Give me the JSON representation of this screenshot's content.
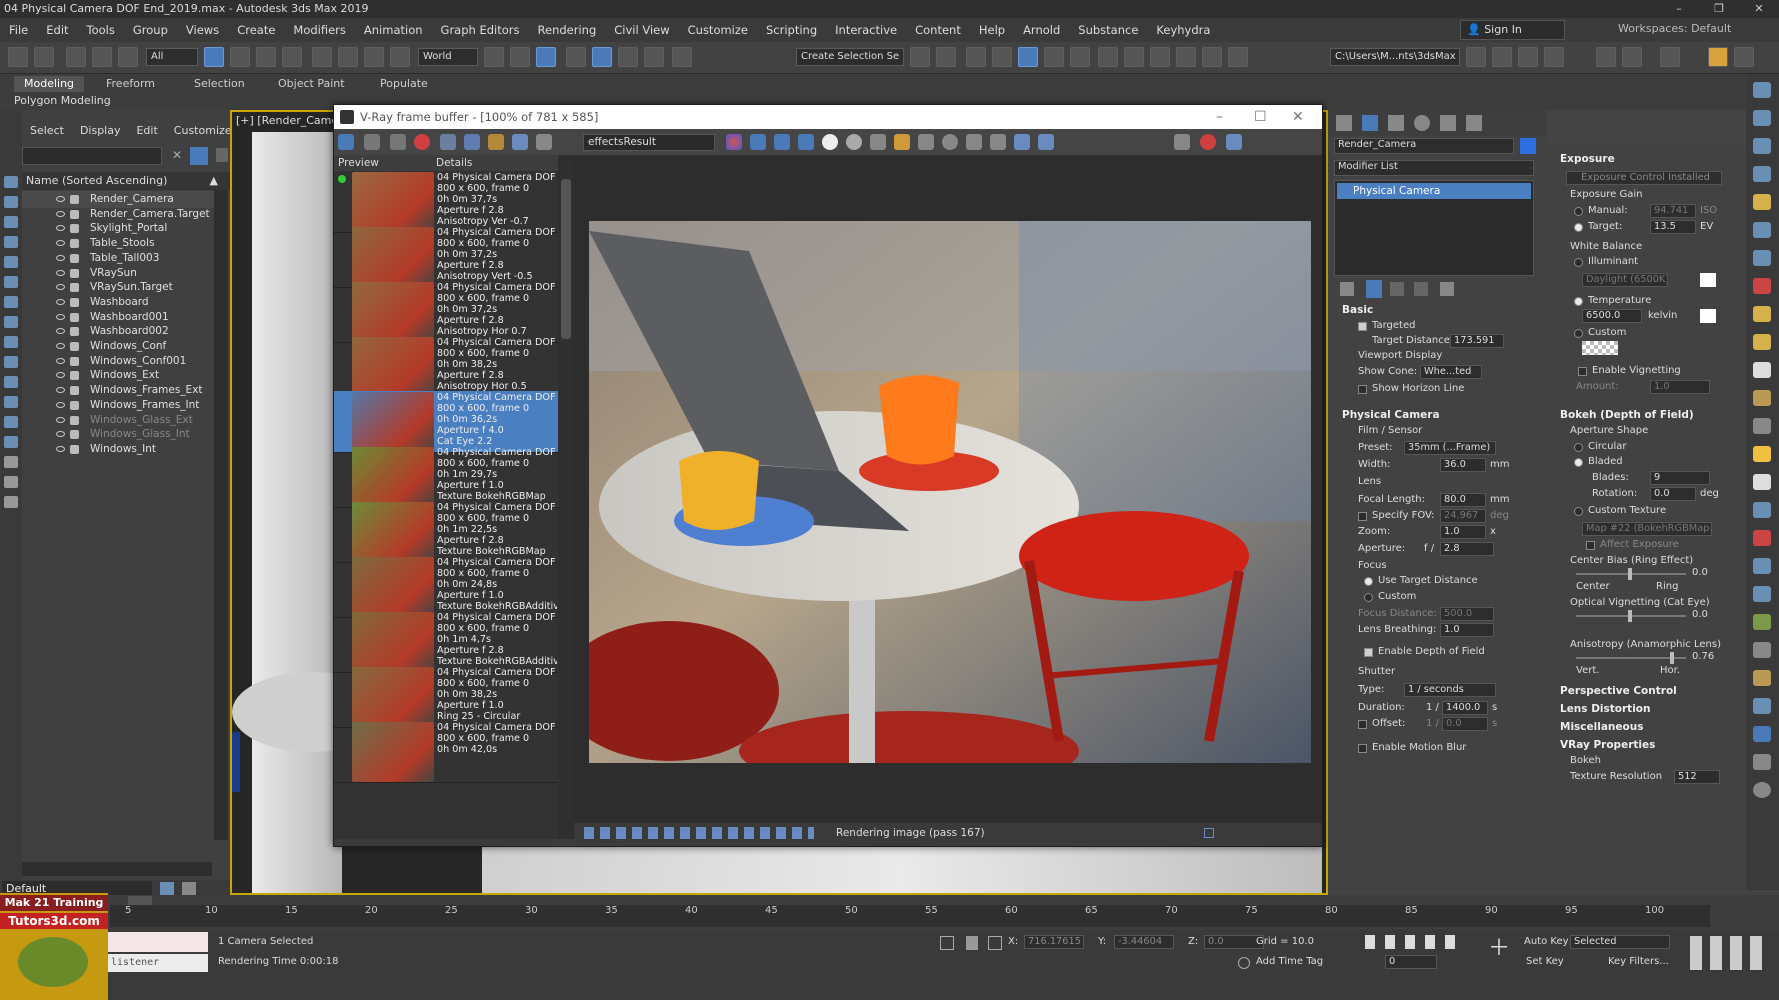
{
  "window": {
    "title": "04 Physical Camera DOF End_2019.max - Autodesk 3ds Max 2019"
  },
  "menu": [
    "File",
    "Edit",
    "Tools",
    "Group",
    "Views",
    "Create",
    "Modifiers",
    "Animation",
    "Graph Editors",
    "Rendering",
    "Civil View",
    "Customize",
    "Scripting",
    "Interactive",
    "Content",
    "Help",
    "Arnold",
    "Substance",
    "Keyhydra"
  ],
  "account": {
    "sign_in": "Sign In",
    "workspaces_label": "Workspaces:",
    "workspace": "Default"
  },
  "toolbar": {
    "filter": "All",
    "refcoord": "World",
    "selection_set": "Create Selection Se",
    "path": "C:\\Users\\M...nts\\3dsMax"
  },
  "ribbon": {
    "tabs": [
      "Modeling",
      "Freeform",
      "Selection",
      "Object Paint",
      "Populate"
    ],
    "sub": "Polygon Modeling"
  },
  "explorer": {
    "tabs": [
      "Select",
      "Display",
      "Edit",
      "Customize"
    ],
    "header": "Name (Sorted Ascending)",
    "items": [
      "Render_Camera",
      "Render_Camera.Target",
      "Skylight_Portal",
      "Table_Stools",
      "Table_Tall003",
      "VRaySun",
      "VRaySun.Target",
      "Washboard",
      "Washboard001",
      "Washboard002",
      "Windows_Conf",
      "Windows_Conf001",
      "Windows_Ext",
      "Windows_Frames_Ext",
      "Windows_Frames_Int",
      "Windows_Glass_Ext",
      "Windows_Glass_Int",
      "Windows_Int"
    ],
    "layer": "Default"
  },
  "viewport": {
    "label": "[+] [Render_Came"
  },
  "vfb": {
    "title": "V-Ray frame buffer - [100% of 781 x 585]",
    "channel": "effectsResult",
    "history_headers": [
      "Preview",
      "Details"
    ],
    "history": [
      [
        "04 Physical Camera DOF E",
        "800 x 600, frame 0",
        "0h 0m 37,7s",
        "Aperture f 2.8",
        "Anisotropy Ver -0.7"
      ],
      [
        "04 Physical Camera DOF E",
        "800 x 600, frame 0",
        "0h 0m 37,2s",
        "Aperture f 2.8",
        "Anisotropy Vert -0.5"
      ],
      [
        "04 Physical Camera DOF E",
        "800 x 600, frame 0",
        "0h 0m 37,2s",
        "Aperture f 2.8",
        "Anisotropy Hor 0.7"
      ],
      [
        "04 Physical Camera DOF E",
        "800 x 600, frame 0",
        "0h 0m 38,2s",
        "Aperture f 2.8",
        "Anisotropy Hor 0.5"
      ],
      [
        "04 Physical Camera DOF E",
        "800 x 600, frame 0",
        "0h 0m 36,2s",
        "Aperture f 4.0",
        "Cat Eye 2.2"
      ],
      [
        "04 Physical Camera DOF E",
        "800 x 600, frame 0",
        "0h 1m 29,7s",
        "Aperture f 1.0",
        "Texture BokehRGBMap"
      ],
      [
        "04 Physical Camera DOF E",
        "800 x 600, frame 0",
        "0h 1m 22,5s",
        "Aperture f 2.8",
        "Texture BokehRGBMap"
      ],
      [
        "04 Physical Camera DOF E",
        "800 x 600, frame 0",
        "0h 0m 24,8s",
        "Aperture f 1.0",
        "Texture BokehRGBAdditive"
      ],
      [
        "04 Physical Camera DOF E",
        "800 x 600, frame 0",
        "0h 1m 4,7s",
        "Aperture f 2.8",
        "Texture BokehRGBAdditive"
      ],
      [
        "04 Physical Camera DOF E",
        "800 x 600, frame 0",
        "0h 0m 38,2s",
        "Aperture f 1.0",
        "Ring 25 - Circular"
      ],
      [
        "04 Physical Camera DOF E",
        "800 x 600, frame 0",
        "0h 0m 42,0s",
        "",
        ""
      ]
    ],
    "status": "Rendering image (pass 167)"
  },
  "modify": {
    "object_name": "Render_Camera",
    "modifier_list": "Modifier List",
    "stack_item": "Physical Camera",
    "basic": {
      "title": "Basic",
      "targeted": "Targeted",
      "target_distance_label": "Target Distance:",
      "target_distance": "173.591",
      "viewport_display": "Viewport Display",
      "show_cone_label": "Show Cone:",
      "show_cone": "Whe...ted",
      "show_horizon": "Show Horizon Line"
    },
    "physical": {
      "title": "Physical Camera",
      "film_sensor": "Film / Sensor",
      "preset_label": "Preset:",
      "preset": "35mm (...Frame)",
      "width_label": "Width:",
      "width": "36.0",
      "width_unit": "mm",
      "lens": "Lens",
      "focal_label": "Focal Length:",
      "focal": "80.0",
      "focal_unit": "mm",
      "fov_label": "Specify FOV:",
      "fov": "24.967",
      "fov_unit": "deg",
      "zoom_label": "Zoom:",
      "zoom": "1.0",
      "zoom_unit": "x",
      "aperture_label": "Aperture:",
      "aperture_f": "f /",
      "aperture": "2.8",
      "focus": "Focus",
      "use_target": "Use Target Distance",
      "custom": "Custom",
      "focus_dist_label": "Focus Distance:",
      "focus_dist": "500.0",
      "lens_breathing_label": "Lens Breathing:",
      "lens_breathing": "1.0",
      "enable_dof": "Enable Depth of Field",
      "shutter": "Shutter",
      "type_label": "Type:",
      "type": "1 / seconds",
      "duration_label": "Duration:",
      "duration_pre": "1 /",
      "duration": "1400.0",
      "duration_unit": "s",
      "offset_label": "Offset:",
      "offset_pre": "1 /",
      "offset": "0.0",
      "offset_unit": "s",
      "motion_blur": "Enable Motion Blur"
    }
  },
  "right_panel": {
    "exposure": {
      "title": "Exposure",
      "installed": "Exposure Control Installed",
      "gain": "Exposure Gain",
      "manual_label": "Manual:",
      "manual": "94.741",
      "manual_unit": "ISO",
      "target_label": "Target:",
      "target": "13.5",
      "target_unit": "EV",
      "white_balance": "White Balance",
      "illuminant": "Illuminant",
      "illuminant_value": "Daylight (6500K)",
      "temperature": "Temperature",
      "temp_value": "6500.0",
      "temp_unit": "kelvin",
      "custom": "Custom",
      "vignetting": "Enable Vignetting",
      "amount_label": "Amount:",
      "amount": "1.0"
    },
    "bokeh": {
      "title": "Bokeh (Depth of Field)",
      "aperture_shape": "Aperture Shape",
      "circular": "Circular",
      "bladed": "Bladed",
      "blades_label": "Blades:",
      "blades": "9",
      "rotation_label": "Rotation:",
      "rotation": "0.0",
      "rotation_unit": "deg",
      "custom_texture": "Custom Texture",
      "texture": "Map #22 (BokehRGBMap.jpg",
      "affect_exposure": "Affect Exposure",
      "center_bias": "Center Bias (Ring Effect)",
      "center_bias_value": "0.0",
      "center": "Center",
      "ring": "Ring",
      "optical_vignetting": "Optical Vignetting (Cat Eye)",
      "optical_value": "0.0",
      "anisotropy": "Anisotropy (Anamorphic Lens)",
      "anisotropy_value": "0.76",
      "vert": "Vert.",
      "hor": "Hor."
    },
    "rollouts": [
      "Perspective Control",
      "Lens Distortion",
      "Miscellaneous",
      "VRay Properties"
    ],
    "vray": {
      "bokeh": "Bokeh",
      "tex_res_label": "Texture Resolution",
      "tex_res": "512"
    }
  },
  "timeline": {
    "ticks": [
      "5",
      "10",
      "15",
      "20",
      "25",
      "30",
      "35",
      "40",
      "45",
      "50",
      "55",
      "60",
      "65",
      "70",
      "75",
      "80",
      "85",
      "90",
      "95",
      "100"
    ],
    "slider": "0 / 100"
  },
  "status": {
    "selection": "1 Camera Selected",
    "render_time": "Rendering Time  0:00:18",
    "maxscript": "listener",
    "x_label": "X:",
    "x": "716.17615",
    "y_label": "Y:",
    "y": "-3.44604",
    "z_label": "Z:",
    "z": "0.0",
    "grid": "Grid = 10.0",
    "add_time_tag": "Add Time Tag",
    "auto_key": "Auto Key",
    "set_key": "Set Key",
    "key_mode": "Selected",
    "key_filters": "Key Filters...",
    "frame": "0"
  },
  "logo": {
    "line1": "Mak 21 Training",
    "line2": "Tutors3d.com"
  }
}
